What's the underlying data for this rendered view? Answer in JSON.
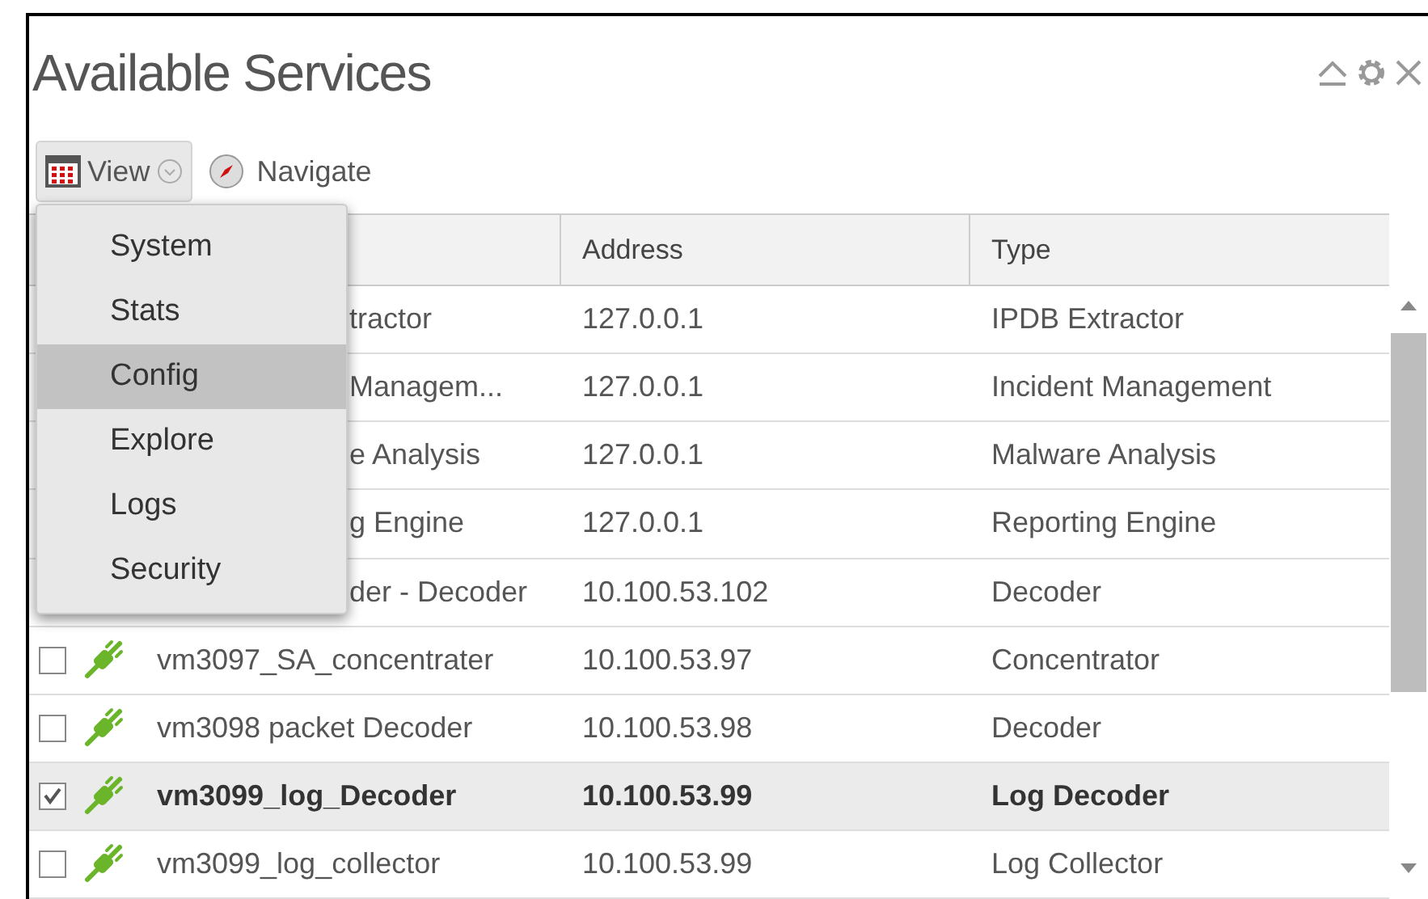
{
  "panel": {
    "title": "Available Services"
  },
  "toolbar": {
    "view_button": "View",
    "navigate_button": "Navigate"
  },
  "view_menu": [
    {
      "label": "System",
      "selected": false
    },
    {
      "label": "Stats",
      "selected": false
    },
    {
      "label": "Config",
      "selected": true
    },
    {
      "label": "Explore",
      "selected": false
    },
    {
      "label": "Logs",
      "selected": false
    },
    {
      "label": "Security",
      "selected": false
    }
  ],
  "table": {
    "columns": [
      "Address",
      "Type"
    ],
    "rows": [
      {
        "kind": "covered",
        "selected": false,
        "name": "tractor",
        "address": "127.0.0.1",
        "type": "IPDB Extractor"
      },
      {
        "kind": "covered",
        "selected": false,
        "name": "Managem...",
        "address": "127.0.0.1",
        "type": "Incident Management"
      },
      {
        "kind": "covered",
        "selected": false,
        "name": "e Analysis",
        "address": "127.0.0.1",
        "type": "Malware Analysis"
      },
      {
        "kind": "covered",
        "selected": false,
        "name": "g Engine",
        "address": "127.0.0.1",
        "type": "Reporting Engine"
      },
      {
        "kind": "covered",
        "selected": false,
        "name": "der - Decoder",
        "address": "10.100.53.102",
        "type": "Decoder"
      },
      {
        "kind": "full",
        "selected": false,
        "checked": false,
        "name": "vm3097_SA_concentrater",
        "address": "10.100.53.97",
        "type": "Concentrator"
      },
      {
        "kind": "full",
        "selected": false,
        "checked": false,
        "name": "vm3098 packet Decoder",
        "address": "10.100.53.98",
        "type": "Decoder"
      },
      {
        "kind": "full",
        "selected": true,
        "checked": true,
        "name": "vm3099_log_Decoder",
        "address": "10.100.53.99",
        "type": "Log Decoder"
      },
      {
        "kind": "full",
        "selected": false,
        "checked": false,
        "name": "vm3099_log_collector",
        "address": "10.100.53.99",
        "type": "Log Collector"
      }
    ]
  }
}
